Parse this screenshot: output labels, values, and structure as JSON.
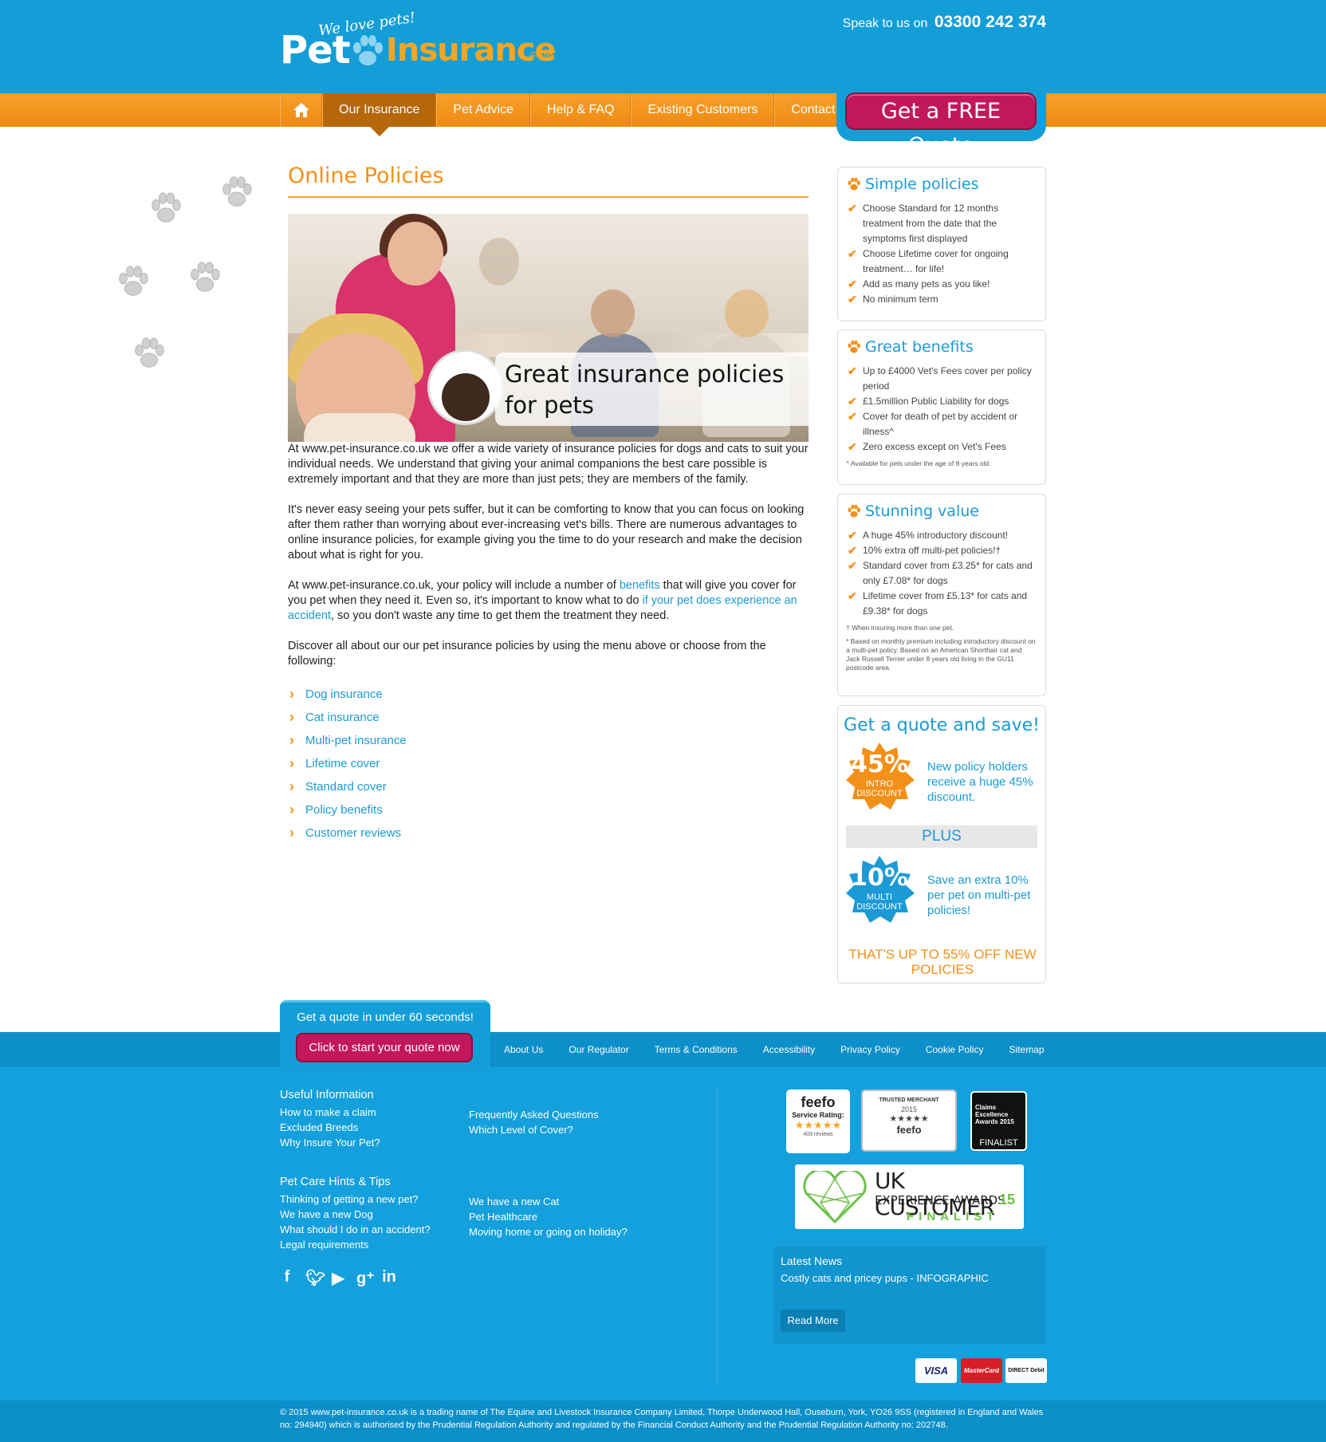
{
  "header": {
    "logo_tagline": "We love pets!",
    "logo_pet": "Pet",
    "logo_insurance": "Insurance",
    "logo_couk": ".co.uk",
    "phone_prefix": "Speak to us on",
    "phone_number": "03300 242 374"
  },
  "nav": {
    "items": [
      {
        "label": "Our Insurance"
      },
      {
        "label": "Pet Advice"
      },
      {
        "label": "Help & FAQ"
      },
      {
        "label": "Existing Customers"
      },
      {
        "label": "Contact"
      }
    ],
    "quote_button": "Get a FREE Quote"
  },
  "main": {
    "title": "Online Policies",
    "hero_caption": "Great insurance policies for pets",
    "p1": "At www.pet-insurance.co.uk we offer a wide variety of insurance policies for dogs and cats to suit your individual needs. We understand that giving your animal companions the best care possible is extremely important and that they are more than just pets; they are members of the family.",
    "p2": "It's never easy seeing your pets suffer, but it can be comforting to know that you can focus on looking after them rather than worrying about ever-increasing vet's bills. There are numerous advantages to online insurance policies, for example giving you the time to do your research and make the decision about what is right for you.",
    "p3_a": "At www.pet-insurance.co.uk, your policy will include a number of ",
    "p3_link1": "benefits",
    "p3_b": " that will give you cover for you pet when they need it. Even so, it's important to know what to do ",
    "p3_link2": "if your pet does experience an accident",
    "p3_c": ", so you don't waste any time to get them the treatment they need.",
    "p4": "Discover all about our our pet insurance policies by using the menu above or choose from the following:",
    "links": [
      "Dog insurance",
      "Cat insurance",
      "Multi-pet insurance",
      "Lifetime cover",
      "Standard cover",
      "Policy benefits",
      "Customer reviews"
    ]
  },
  "sidebar": {
    "simple": {
      "title": "Simple policies",
      "items": [
        "Choose Standard for 12 months treatment from the date that the symptoms first displayed",
        "Choose Lifetime cover for ongoing treatment… for life!",
        "Add as many pets as you like!",
        "No minimum term"
      ]
    },
    "benefits": {
      "title": "Great benefits",
      "items": [
        "Up to £4000 Vet's Fees cover per policy period",
        "£1.5million Public Liability for dogs",
        "Cover for death of pet by accident or illness^",
        "Zero excess except on Vet's Fees"
      ],
      "note": "^ Available for pets under the age of 8 years old."
    },
    "value": {
      "title": "Stunning value",
      "items": [
        "A huge 45% introductory discount!",
        "10% extra off multi-pet policies!†",
        "Standard cover from £3.25* for cats and only £7.08* for dogs",
        "Lifetime cover from £5.13* for cats and £9.38* for dogs"
      ],
      "note1": "† When insuring more than one pet.",
      "note2": "* Based on monthly premium including introductory discount on a multi-pet policy. Based on an American Shorthair cat and Jack Russell Terrier under 8 years old living in the GU11 postcode area."
    },
    "quote": {
      "title": "Get a quote and save!",
      "badge1_num": "45%",
      "badge1_label": "INTRO DISCOUNT",
      "badge1_text": "New policy holders receive a huge 45% discount.",
      "plus": "PLUS",
      "badge2_num": "10%",
      "badge2_label": "MULTI DISCOUNT",
      "badge2_text": "Save an extra 10% per pet on multi-pet policies!",
      "upto": "THAT'S UP TO 55% OFF NEW POLICIES"
    }
  },
  "footer": {
    "quote_tab_text": "Get a quote in under 60 seconds!",
    "quote_tab_button": "Click to start your quote now",
    "links": [
      "About Us",
      "Our Regulator",
      "Terms & Conditions",
      "Accessibility",
      "Privacy Policy",
      "Cookie Policy",
      "Sitemap"
    ],
    "useful_title": "Useful Information",
    "useful_col1": [
      "How to make a claim",
      "Excluded Breeds",
      "Why Insure Your Pet?"
    ],
    "useful_col2": [
      "Frequently Asked Questions",
      "Which Level of Cover?"
    ],
    "tips_title": "Pet Care Hints & Tips",
    "tips_col1": [
      "Thinking of getting a new pet?",
      "We have a new Dog",
      "What should I do in an accident?",
      "Legal requirements"
    ],
    "tips_col2": [
      "We have a new Cat",
      "Pet Healthcare",
      "Moving home or going on holiday?"
    ],
    "feefo_label": "feefo",
    "feefo_rating": "Service Rating:",
    "feefo_reviews": "403 reviews",
    "trusted_merchant": "TRUSTED MERCHANT",
    "trusted_year": "2015",
    "claims_award": "Claims Excellence Awards 2015",
    "claims_finalist": "FINALIST",
    "ukcx_line1": "UK CUSTOMER",
    "ukcx_line2": "EXPERIENCE AWARDS",
    "ukcx_year": "15",
    "ukcx_finalist": "FINALIST",
    "news_title": "Latest News",
    "news_item": "Costly cats and pricey pups - INFOGRAPHIC",
    "news_button": "Read More",
    "cards": [
      "VISA",
      "MasterCard",
      "DIRECT Debit"
    ],
    "legal": "© 2015 www.pet-insurance.co.uk is a trading name of The Equine and Livestock Insurance Company Limited, Thorpe Underwood Hall, Ouseburn, York, YO26 9SS (registered in England and Wales no: 294940) which is authorised by the Prudential Regulation Authority and regulated by the Financial Conduct Authority and the Prudential Regulation Authority no: 202748."
  },
  "colors": {
    "brand_blue": "#139ed8",
    "orange": "#f39019",
    "magenta": "#c2185b"
  }
}
